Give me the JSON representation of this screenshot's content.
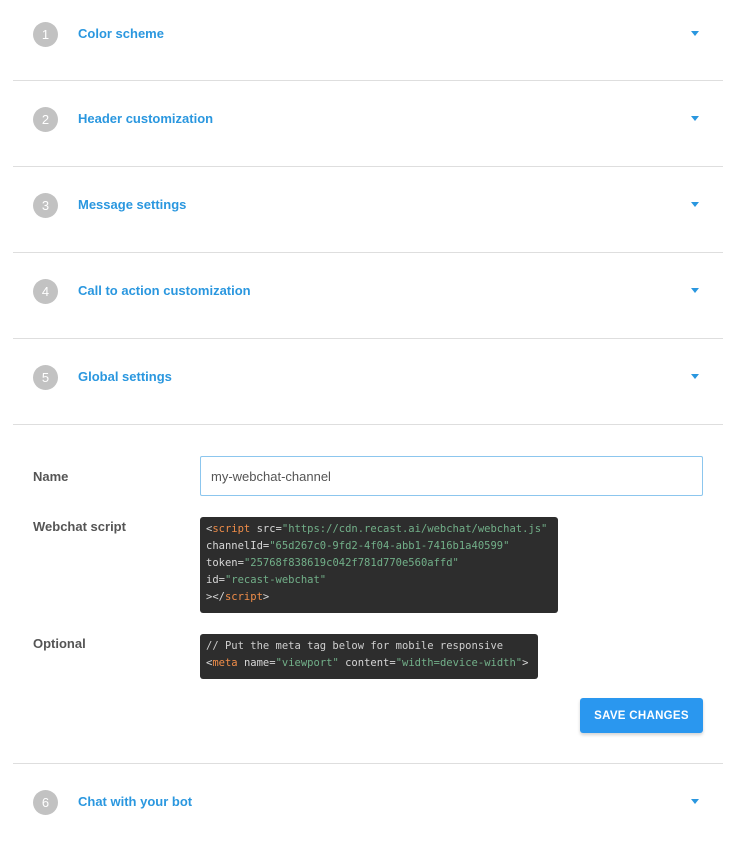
{
  "sections": [
    {
      "number": "1",
      "title": "Color scheme"
    },
    {
      "number": "2",
      "title": "Header customization"
    },
    {
      "number": "3",
      "title": "Message settings"
    },
    {
      "number": "4",
      "title": "Call to action customization"
    },
    {
      "number": "5",
      "title": "Global settings"
    },
    {
      "number": "6",
      "title": "Chat with your bot"
    }
  ],
  "panel": {
    "name_label": "Name",
    "name_value": "my-webchat-channel",
    "script_label": "Webchat script",
    "script_code": {
      "l1_open": "<",
      "l1_tag": "script",
      "l1_attr": " src=",
      "l1_src": "\"https://cdn.recast.ai/webchat/webchat.js\"",
      "l2_attr": "channelId=",
      "l2_val": "\"65d267c0-9fd2-4f04-abb1-7416b1a40599\"",
      "l3_attr": "token=",
      "l3_val": "\"25768f838619c042f781d770e560affd\"",
      "l4_attr": "id=",
      "l4_val": "\"recast-webchat\"",
      "l5_close_open": "></",
      "l5_tag": "script",
      "l5_close": ">"
    },
    "optional_label": "Optional",
    "optional_code": {
      "comment": "// Put the meta tag below for mobile responsive",
      "open": "<",
      "tag": "meta",
      "attr1": " name=",
      "val1": "\"viewport\"",
      "attr2": " content=",
      "val2": "\"width=device-width\"",
      "close": ">"
    },
    "save_label": "SAVE CHANGES"
  },
  "colors": {
    "accent": "#2a97df",
    "badge": "#c2c2c2",
    "button": "#2a97ef",
    "code_bg": "#2d2d2d"
  }
}
